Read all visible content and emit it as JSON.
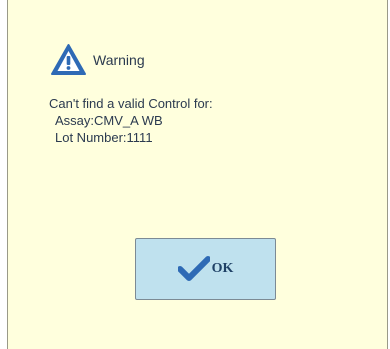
{
  "dialog": {
    "title": "Warning",
    "icon": "warning-triangle-icon",
    "message": {
      "line1": "Can't find a valid Control for:",
      "line2": "Assay:CMV_A WB",
      "line3": "Lot Number:1111"
    },
    "ok_button": {
      "label": "OK",
      "icon": "checkmark-icon"
    }
  },
  "colors": {
    "dialog_background": "#ffffdd",
    "button_background": "#bfe1ee",
    "accent_blue": "#2e6ab5",
    "text": "#2b3a4f"
  }
}
